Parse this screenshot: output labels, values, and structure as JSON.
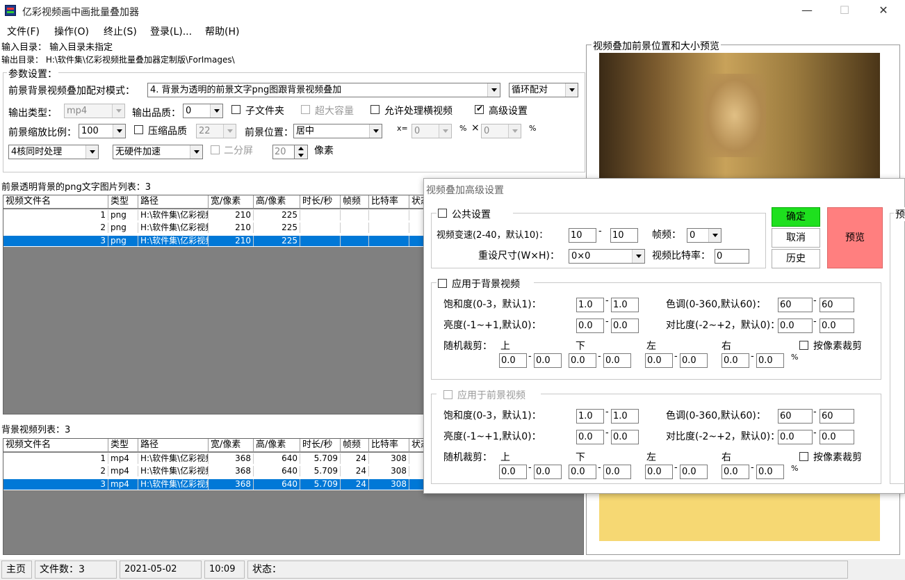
{
  "window": {
    "title": "亿彩视频画中画批量叠加器",
    "minimize": "—",
    "maximize": "☐",
    "close": "✕"
  },
  "menu": [
    "文件(F)",
    "操作(O)",
    "终止(S)",
    "登录(L)...",
    "帮助(H)"
  ],
  "input_dir": "输入目录：  输入目录未指定",
  "output_dir": "输出目录：  H:\\软件集\\亿彩视频批量叠加器定制版\\ForImages\\",
  "params": {
    "group_title": "参数设置：",
    "mode_label": "前景背景视频叠加配对模式：",
    "mode_value": "4. 背景为透明的前景文字png图跟背景视频叠加",
    "loop_value": "循环配对",
    "out_type_label": "输出类型：",
    "out_type_value": "mp4",
    "quality_label": "输出品质：",
    "quality_value": "0",
    "subfolder": "子文件夹",
    "large": "超大容量",
    "horizontal": "允许处理横视频",
    "advanced": "高级设置",
    "scale_label": "前景缩放比例：",
    "scale_value": "100",
    "compress": "压缩品质",
    "compress_value": "22",
    "pos_label": "前景位置：",
    "pos_value": "居中",
    "x_label": "x=",
    "x_value": "0",
    "pct1": "%",
    "times": "×",
    "y_value": "0",
    "pct2": "%",
    "cores_value": "4核同时处理",
    "hw_value": "无硬件加速",
    "split": "二分屏",
    "px_value": "20",
    "px_label": "像素"
  },
  "fg_list": {
    "title": "前景透明背景的png文字图片列表：3",
    "cols": [
      "视频文件名",
      "类型",
      "路径",
      "宽/像素",
      "高/像素",
      "时长/秒",
      "帧频",
      "比特率",
      "状态"
    ],
    "rows": [
      [
        "1",
        "png",
        "H:\\软件集\\亿彩视频",
        "210",
        "225",
        "",
        "",
        ""
      ],
      [
        "2",
        "png",
        "H:\\软件集\\亿彩视频",
        "210",
        "225",
        "",
        "",
        ""
      ],
      [
        "3",
        "png",
        "H:\\软件集\\亿彩视频",
        "210",
        "225",
        "",
        "",
        ""
      ]
    ]
  },
  "bg_list": {
    "title": "背景视频列表：3",
    "cols": [
      "视频文件名",
      "类型",
      "路径",
      "宽/像素",
      "高/像素",
      "时长/秒",
      "帧频",
      "比特率",
      "状态"
    ],
    "rows": [
      [
        "1",
        "mp4",
        "H:\\软件集\\亿彩视频",
        "368",
        "640",
        "5.709",
        "24",
        "308"
      ],
      [
        "2",
        "mp4",
        "H:\\软件集\\亿彩视频",
        "368",
        "640",
        "5.709",
        "24",
        "308"
      ],
      [
        "3",
        "mp4",
        "H:\\软件集\\亿彩视频",
        "368",
        "640",
        "5.709",
        "24",
        "308"
      ]
    ]
  },
  "preview": {
    "title": "视频叠加前景位置和大小预览"
  },
  "dialog": {
    "title": "视频叠加高级设置",
    "common": "公共设置",
    "speed_label": "视频变速(2-40，默认10)：",
    "speed_a": "10",
    "speed_b": "10",
    "dash": "-",
    "fps_label": "帧频：",
    "fps_value": "0",
    "resize_label": "重设尺寸(W×H)：",
    "resize_value": "0×0",
    "bitrate_label": "视频比特率：",
    "bitrate_value": "0",
    "ok": "确定",
    "cancel": "取消",
    "history": "历史",
    "preview": "预览",
    "side_label": "预",
    "bg_title": "应用于背景视频",
    "fg_title": "应用于前景视频",
    "sat_label": "饱和度(0-3，默认1)：",
    "sat_a": "1.0",
    "sat_b": "1.0",
    "hue_label": "色调(0-360,默认60)：",
    "hue_a": "60",
    "hue_b": "60",
    "bri_label": "亮度(-1~+1,默认0)：",
    "bri_a": "0.0",
    "bri_b": "0.0",
    "con_label": "对比度(-2~+2，默认0)：",
    "con_a": "0.0",
    "con_b": "0.0",
    "crop_label": "随机裁剪：",
    "top": "上",
    "bottom": "下",
    "left": "左",
    "right": "右",
    "pixel_crop": "按像素裁剪",
    "crop_val": "0.0",
    "pct": "%"
  },
  "status": {
    "home": "主页",
    "files": "文件数：3",
    "date": "2021-05-02",
    "time": "10:09",
    "state": "状态："
  }
}
